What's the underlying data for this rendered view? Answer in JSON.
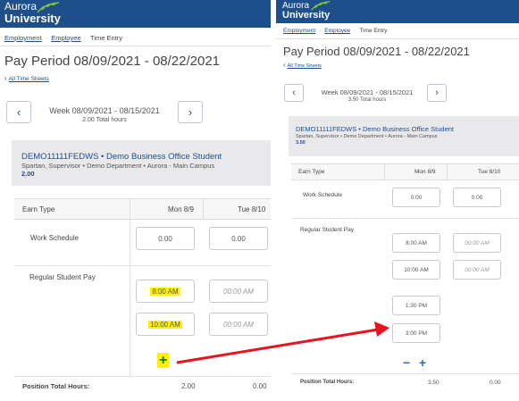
{
  "brand": {
    "line1": "Aurora",
    "line2": "University"
  },
  "breadcrumb": [
    "Employment",
    "Employee",
    "Time Entry"
  ],
  "pay_period_title": "Pay Period 08/09/2021 - 08/22/2021",
  "all_time_sheets": "All Time Sheets",
  "nav": {
    "prev": "‹",
    "next": "›"
  },
  "left": {
    "week_label": "Week 08/09/2021 - 08/15/2021",
    "week_hours": "2.00 Total hours",
    "job_title": "DEMO11111FEDWS • Demo Business Office Student",
    "job_sub": "Spartan, Supervisor • Demo Department • Aurora - Main Campus",
    "job_hours": "2.00",
    "columns": {
      "earn_type": "Earn Type",
      "day1": "Mon 8/9",
      "day2": "Tue 8/10"
    },
    "work_schedule": {
      "label": "Work Schedule",
      "mon": "0.00",
      "tue": "0.00"
    },
    "regular_pay": {
      "label": "Regular Student Pay",
      "mon_in": "8:00 AM",
      "mon_out": "10:00 AM",
      "tue_in": "00:00 AM",
      "tue_out": "00:00 AM"
    },
    "add_symbol": "+",
    "footer": {
      "label": "Position Total Hours:",
      "mon": "2.00",
      "tue": "0.00"
    }
  },
  "right": {
    "week_label": "Week 08/09/2021 - 08/15/2021",
    "week_hours": "3.50 Total hours",
    "job_title": "DEMO11111FEDWS • Demo Business Office Student",
    "job_sub": "Spartan, Supervisor • Demo Department • Aurora - Main Campus",
    "job_hours": "3.50",
    "columns": {
      "earn_type": "Earn Type",
      "day1": "Mon 8/9",
      "day2": "Tue 8/10"
    },
    "work_schedule": {
      "label": "Work Schedule",
      "mon": "0.00",
      "tue": "0.00"
    },
    "regular_pay": {
      "label": "Regular Student Pay",
      "mon_in": "8:00 AM",
      "mon_out": "10:00 AM",
      "mon_in2": "1:30 PM",
      "mon_out2": "3:00 PM",
      "tue_in": "00:00 AM",
      "tue_out": "00:00 AM"
    },
    "minus_symbol": "−",
    "add_symbol": "+",
    "footer": {
      "label": "Position Total Hours:",
      "mon": "3.50",
      "tue": "0.00"
    }
  },
  "colors": {
    "brand_blue": "#1e4f8a",
    "highlight": "#fff200",
    "arrow": "#e8141d",
    "plus_green": "#1a7a1a"
  }
}
